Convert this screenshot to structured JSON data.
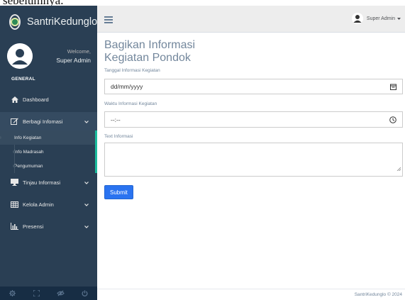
{
  "caption": "sebelumnya.",
  "brand": {
    "name": "SantriKedunglo"
  },
  "profile": {
    "welcome": "Welcome,",
    "name": "Super Admin"
  },
  "sidebar": {
    "section_title": "GENERAL",
    "items": [
      {
        "label": "Dashboard",
        "icon": "home-icon"
      },
      {
        "label": "Berbagi Infomasi",
        "icon": "edit-icon"
      },
      {
        "label": "Tinjau Informasi",
        "icon": "desktop-icon"
      },
      {
        "label": "Kelola Admin",
        "icon": "table-icon"
      },
      {
        "label": "Presensi",
        "icon": "bar-chart-icon"
      }
    ],
    "subitems": [
      {
        "label": "Info Kegiatan"
      },
      {
        "label": "Info Madrasah"
      },
      {
        "label": "Pengumuman"
      }
    ],
    "footer_icons": [
      "settings-icon",
      "fullscreen-icon",
      "eye-slash-icon",
      "power-icon"
    ]
  },
  "topbar": {
    "user": "Super Admin"
  },
  "form": {
    "title": "Bagikan Informasi Kegiatan Pondok",
    "date_label": "Tanggal Informasi Kegiatan",
    "date_value": "dd/mm/yyyy",
    "time_label": "Waktu Informasi Kegiatan",
    "time_value": "--:--",
    "text_label": "Text Informasi",
    "submit": "Submit"
  },
  "footer": {
    "text": "SantriKedunglo © 2024"
  },
  "colors": {
    "sidebar": "#2a3f54",
    "accent": "#1abb9c",
    "button": "#2a73f0"
  }
}
